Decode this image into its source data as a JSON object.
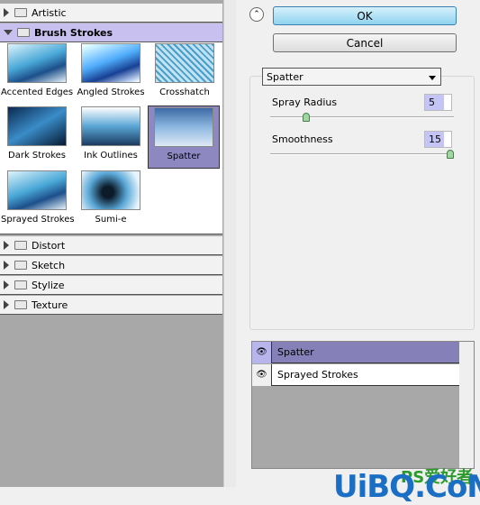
{
  "categories_top": [
    {
      "label": "Artistic",
      "open": false
    },
    {
      "label": "Brush Strokes",
      "open": true
    }
  ],
  "thumbnails": [
    {
      "label": "Accented Edges",
      "selected": false
    },
    {
      "label": "Angled Strokes",
      "selected": false
    },
    {
      "label": "Crosshatch",
      "selected": false
    },
    {
      "label": "Dark Strokes",
      "selected": false
    },
    {
      "label": "Ink Outlines",
      "selected": false
    },
    {
      "label": "Spatter",
      "selected": true
    },
    {
      "label": "Sprayed Strokes",
      "selected": false
    },
    {
      "label": "Sumi-e",
      "selected": false
    }
  ],
  "categories_bottom": [
    {
      "label": "Distort"
    },
    {
      "label": "Sketch"
    },
    {
      "label": "Stylize"
    },
    {
      "label": "Texture"
    }
  ],
  "buttons": {
    "ok": "OK",
    "cancel": "Cancel"
  },
  "filter_select": "Spatter",
  "params": [
    {
      "label": "Spray Radius",
      "value": "5",
      "max": 25,
      "fraction": 0.2
    },
    {
      "label": "Smoothness",
      "value": "15",
      "max": 15,
      "fraction": 1.0
    }
  ],
  "layers": [
    {
      "label": "Spatter",
      "selected": true
    },
    {
      "label": "Sprayed Strokes",
      "selected": false
    }
  ],
  "watermark": {
    "text": "UiBQ.CoM",
    "sub": "PS爱好者"
  },
  "colors": {
    "selection": "#8d88c0",
    "header_open": "#c8c0ee",
    "ok_button": "#8fd3ef"
  }
}
